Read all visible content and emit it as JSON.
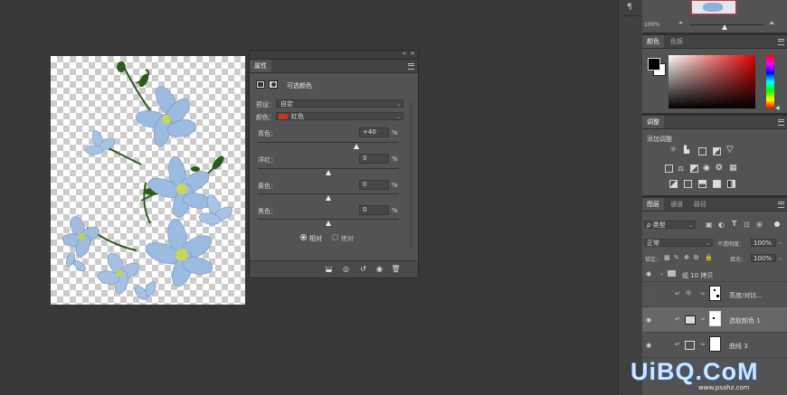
{
  "properties_panel": {
    "collapse_glyph": "«",
    "close_glyph": "×",
    "tab_label": "属性",
    "adjustment_title": "可选颜色",
    "preset_label": "预设：",
    "preset_value": "自定",
    "colors_label": "颜色：",
    "colors_value": "红色",
    "color_swatch": "#c8341e",
    "sliders": [
      {
        "label": "青色：",
        "value": "+40",
        "unit": "%",
        "level": 0.7
      },
      {
        "label": "洋红：",
        "value": "0",
        "unit": "%",
        "level": 0.5
      },
      {
        "label": "黄色：",
        "value": "0",
        "unit": "%",
        "level": 0.5
      },
      {
        "label": "黑色：",
        "value": "0",
        "unit": "%",
        "level": 0.5
      }
    ],
    "mode_relative": "相对",
    "mode_absolute": "绝对",
    "bottom_icons": [
      "clip-to-layer-icon",
      "view-previous-icon",
      "reset-icon",
      "visibility-icon",
      "delete-icon"
    ]
  },
  "navigator": {
    "zoom": "100%"
  },
  "color_panel": {
    "tabs": [
      "颜色",
      "色板"
    ],
    "foreground": "#000000",
    "background": "#ffffff",
    "picker_hue": "#e00000"
  },
  "adjustments_panel": {
    "tab": "调整",
    "subtitle": "添加调整"
  },
  "layers_panel": {
    "tabs": [
      "图层",
      "通道",
      "路径"
    ],
    "filter_label": "ρ 类型",
    "blend_mode": "正常",
    "opacity_label": "不透明度：",
    "opacity_value": "100%",
    "lock_label": "锁定：",
    "fill_label": "填充：",
    "fill_value": "100%",
    "layers": [
      {
        "name": "组 10 拷贝",
        "visible": true,
        "type": "group"
      },
      {
        "name": "亮度/对比...",
        "visible": false,
        "type": "adjustment"
      },
      {
        "name": "选取颜色 1",
        "visible": true,
        "type": "adjustment",
        "selected": true
      },
      {
        "name": "曲线 3",
        "visible": true,
        "type": "adjustment"
      }
    ]
  },
  "watermark": {
    "main": "UiBQ.CoM",
    "sub": "www.psahz.com"
  }
}
